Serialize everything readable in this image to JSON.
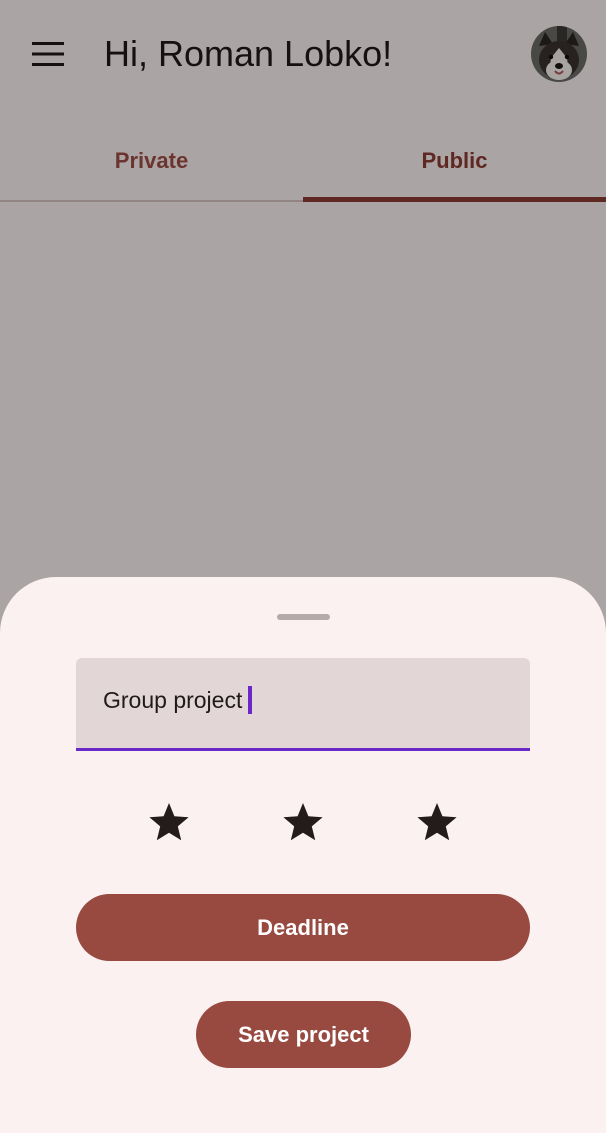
{
  "header": {
    "greeting": "Hi, Roman Lobko!",
    "menu_icon": "hamburger-menu-icon",
    "avatar_icon": "user-avatar-dog"
  },
  "tabs": [
    {
      "label": "Private",
      "selected": false
    },
    {
      "label": "Public",
      "selected": true
    }
  ],
  "sheet": {
    "project_name": "Group project",
    "rating": {
      "max": 3,
      "filled": 3,
      "icon": "star-icon"
    },
    "deadline_label": "Deadline",
    "save_label": "Save project"
  },
  "colors": {
    "primary": "#8e3b33",
    "button": "#984a41",
    "focus_indicator": "#6a28c8",
    "surface": "#fcf2f2"
  }
}
